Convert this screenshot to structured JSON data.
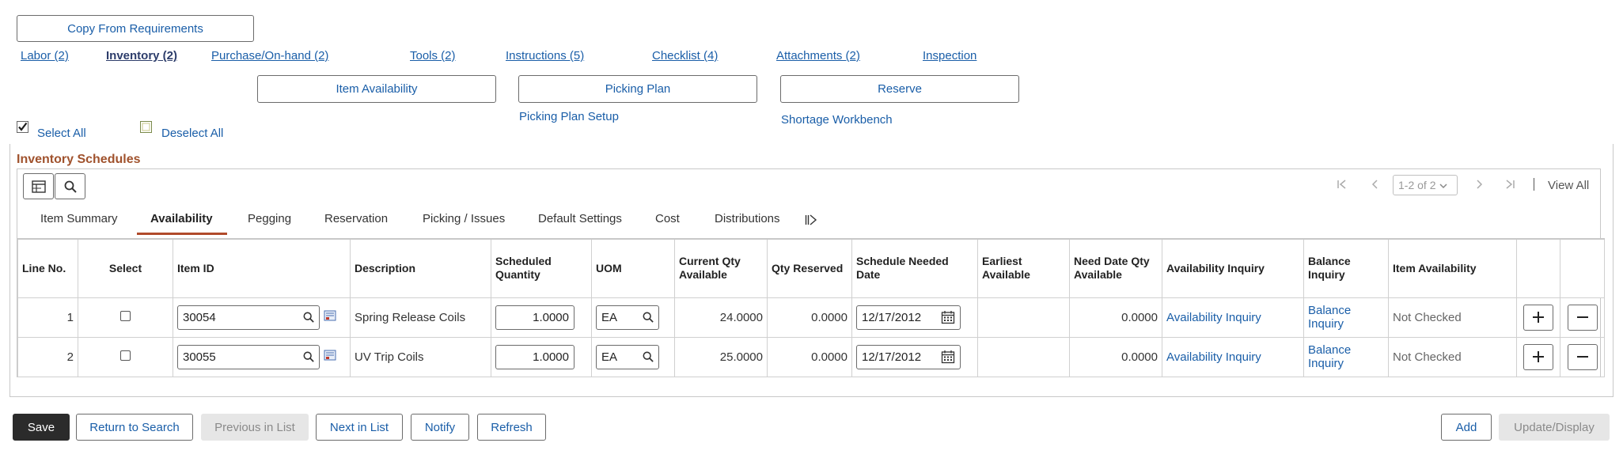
{
  "top_button": "Copy From Requirements",
  "nav_links": [
    {
      "label": "Labor (2)"
    },
    {
      "label": "Inventory (2)"
    },
    {
      "label": "Purchase/On-hand (2)"
    },
    {
      "label": "Tools (2)"
    },
    {
      "label": "Instructions (5)"
    },
    {
      "label": "Checklist (4)"
    },
    {
      "label": "Attachments (2)"
    },
    {
      "label": "Inspection"
    }
  ],
  "action_buttons": {
    "item_availability": "Item Availability",
    "picking_plan": "Picking Plan",
    "reserve": "Reserve"
  },
  "action_links": {
    "picking_plan_setup": "Picking Plan Setup",
    "shortage_workbench": "Shortage Workbench"
  },
  "selection": {
    "select_all": "Select All",
    "deselect_all": "Deselect All"
  },
  "section_title": "Inventory Schedules",
  "pager": {
    "range": "1-2 of 2",
    "view_all": "View All"
  },
  "tabs": [
    "Item Summary",
    "Availability",
    "Pegging",
    "Reservation",
    "Picking / Issues",
    "Default Settings",
    "Cost",
    "Distributions"
  ],
  "columns": [
    "Line No.",
    "Select",
    "Item ID",
    "Description",
    "Scheduled Quantity",
    "UOM",
    "Current Qty Available",
    "Qty Reserved",
    "Schedule Needed Date",
    "Earliest Available",
    "Need Date Qty Available",
    "Availability Inquiry",
    "Balance Inquiry",
    "Item Availability"
  ],
  "rows": [
    {
      "line": "1",
      "item_id": "30054",
      "description": "Spring Release Coils",
      "sched_qty": "1.0000",
      "uom": "EA",
      "current_qty": "24.0000",
      "qty_reserved": "0.0000",
      "needed_date": "12/17/2012",
      "earliest": "",
      "need_date_qty": "0.0000",
      "avail_inquiry": "Availability Inquiry",
      "balance_inquiry": "Balance Inquiry",
      "item_availability": "Not Checked"
    },
    {
      "line": "2",
      "item_id": "30055",
      "description": "UV Trip Coils",
      "sched_qty": "1.0000",
      "uom": "EA",
      "current_qty": "25.0000",
      "qty_reserved": "0.0000",
      "needed_date": "12/17/2012",
      "earliest": "",
      "need_date_qty": "0.0000",
      "avail_inquiry": "Availability Inquiry",
      "balance_inquiry": "Balance Inquiry",
      "item_availability": "Not Checked"
    }
  ],
  "bottom_buttons": {
    "save": "Save",
    "return": "Return to Search",
    "previous": "Previous in List",
    "next": "Next in List",
    "notify": "Notify",
    "refresh": "Refresh",
    "add": "Add",
    "update": "Update/Display"
  },
  "colors": {
    "link": "#1a5ea8",
    "section_title": "#a0522d",
    "active_tab_underline": "#b04a2a",
    "primary": "#2b2b2b"
  }
}
